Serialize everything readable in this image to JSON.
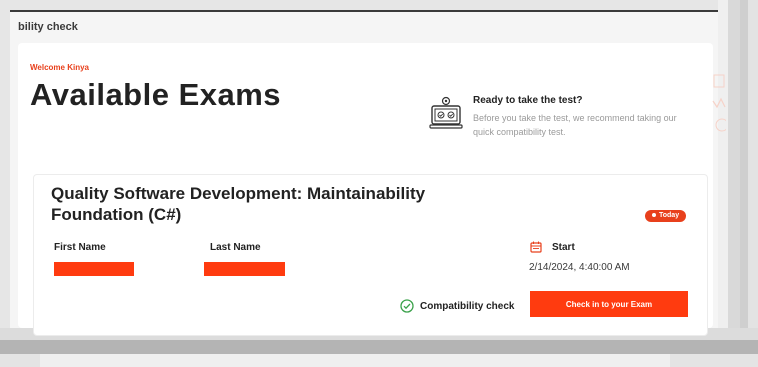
{
  "header": {
    "breadcrumb": "bility check"
  },
  "welcome": "Welcome Kinya",
  "page_title": "Available Exams",
  "ready": {
    "title": "Ready to take the test?",
    "description": "Before you take the test, we recommend taking our quick compatibility test."
  },
  "exam": {
    "title": "Quality Software Development: Maintainability Foundation (C#)",
    "badge": "Today",
    "first_name_label": "First Name",
    "last_name_label": "Last Name",
    "start_label": "Start",
    "start_value": "2/14/2024, 4:40:00 AM",
    "compatibility_label": "Compatibility check",
    "checkin_label": "Check in to your Exam"
  },
  "colors": {
    "accent": "#ff3b0f",
    "welcome": "#e8401c",
    "success": "#3aa14a"
  },
  "icons": [
    "computer-check-icon",
    "calendar-icon",
    "check-circle-icon"
  ]
}
